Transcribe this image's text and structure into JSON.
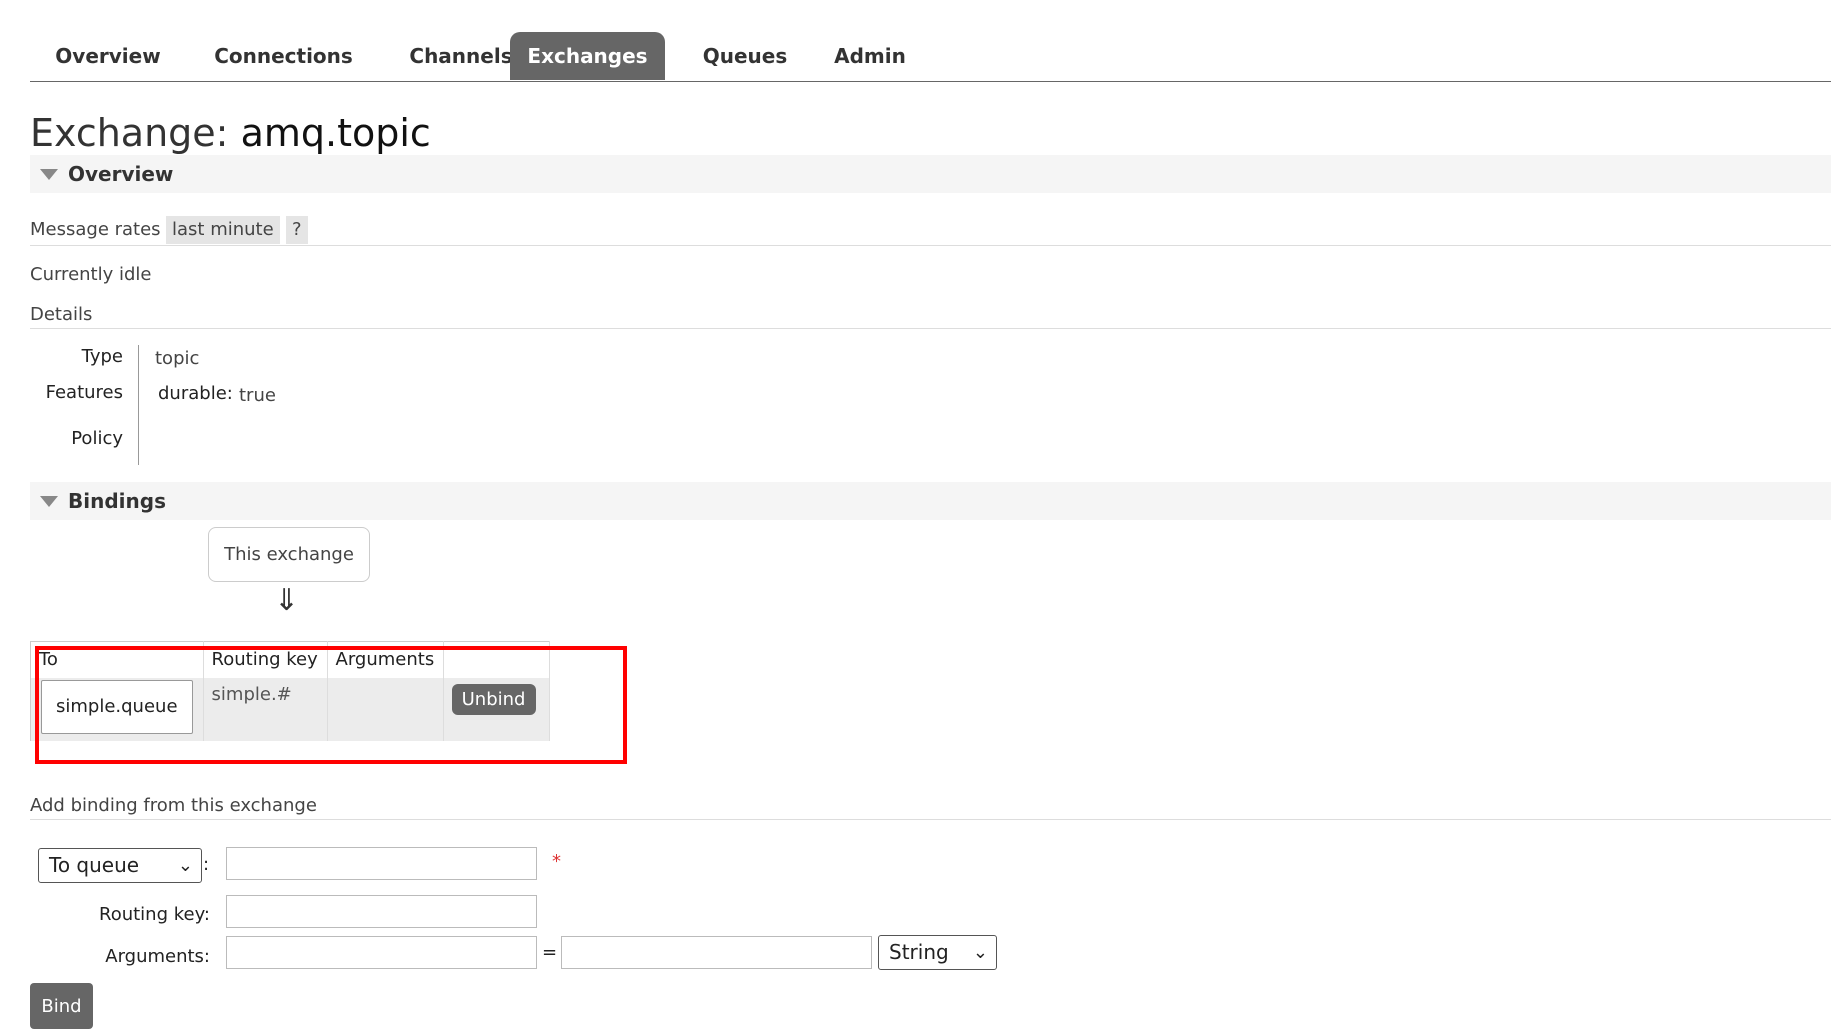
{
  "nav": {
    "tabs": [
      {
        "label": "Overview"
      },
      {
        "label": "Connections"
      },
      {
        "label": "Channels"
      },
      {
        "label": "Exchanges",
        "active": true
      },
      {
        "label": "Queues"
      },
      {
        "label": "Admin"
      }
    ]
  },
  "page": {
    "title_prefix": "Exchange:",
    "title_name": "amq.topic"
  },
  "overview": {
    "header": "Overview",
    "message_rates_label": "Message rates",
    "rate_period": "last minute",
    "help": "?",
    "status": "Currently idle",
    "details_label": "Details",
    "details": {
      "type_key": "Type",
      "type_value": "topic",
      "features_key": "Features",
      "features_name": "durable:",
      "features_value": "true",
      "policy_key": "Policy"
    }
  },
  "bindings": {
    "header": "Bindings",
    "this_exchange": "This exchange",
    "arrow": "⇓",
    "columns": [
      "To",
      "Routing key",
      "Arguments",
      ""
    ],
    "rows": [
      {
        "to": "simple.queue",
        "routing_key": "simple.#",
        "arguments": "",
        "action": "Unbind"
      }
    ]
  },
  "add_binding": {
    "label": "Add binding from this exchange",
    "destination_type": "To queue",
    "colon": ":",
    "required_mark": "*",
    "routing_key_label": "Routing key:",
    "arguments_label": "Arguments:",
    "equals": "=",
    "arg_type": "String",
    "bind_button": "Bind"
  },
  "colors": {
    "nav_active_bg": "#666666",
    "highlight": "#ff0000"
  }
}
